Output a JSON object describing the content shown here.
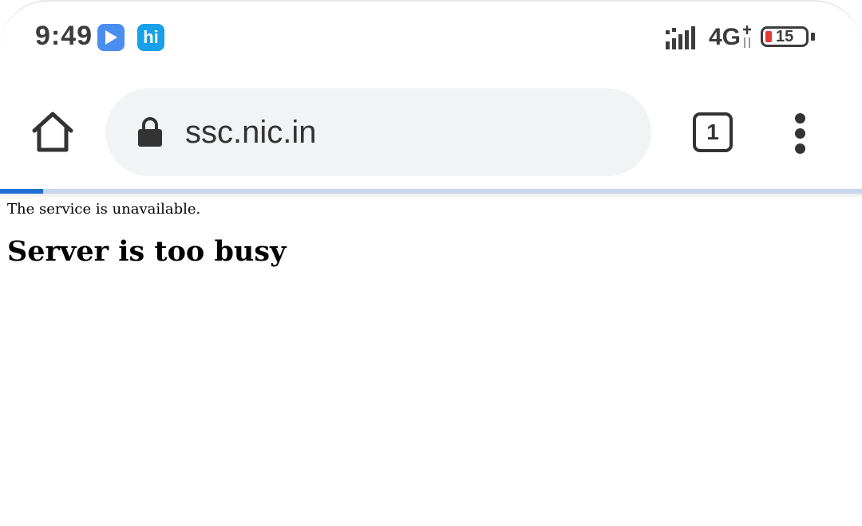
{
  "status_bar": {
    "time": "9:49",
    "app_icons": [
      "play-app-icon",
      "hi-app-icon"
    ],
    "hi_icon_text": "hi",
    "network_type": "4G",
    "battery_level": "15",
    "battery_color": "#e53935"
  },
  "toolbar": {
    "url": "ssc.nic.in",
    "tab_count": "1",
    "icons": [
      "home-icon",
      "lock-icon",
      "tab-switcher-icon",
      "more-vert-icon"
    ]
  },
  "progress": {
    "fraction": 0.05,
    "color": "#1f6fd6"
  },
  "page": {
    "message": "The service is unavailable.",
    "heading": "Server is too busy"
  }
}
